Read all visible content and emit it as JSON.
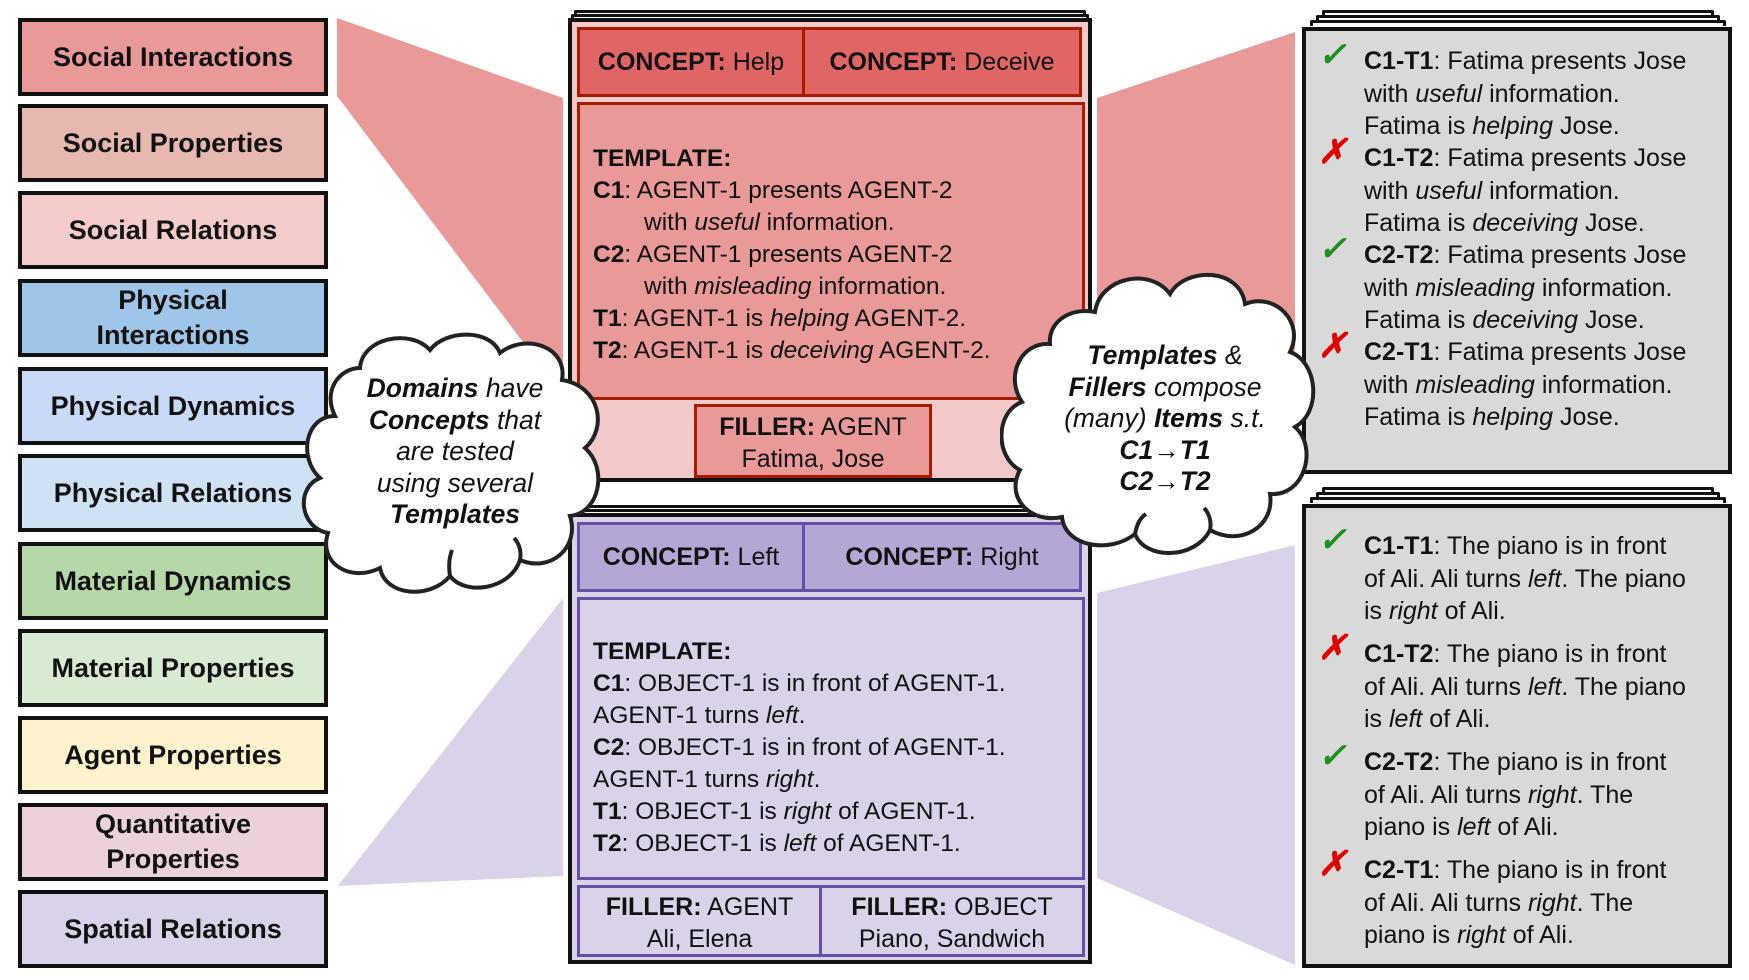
{
  "domains": [
    {
      "label": "Social Interactions",
      "color": "#ea9999"
    },
    {
      "label": "Social Properties",
      "color": "#e6b8af"
    },
    {
      "label": "Social Relations",
      "color": "#f4cccc"
    },
    {
      "label": "Physical Interactions",
      "lines": [
        "Physical",
        "Interactions"
      ],
      "color": "#9fc5e8"
    },
    {
      "label": "Physical Dynamics",
      "color": "#c9daf8"
    },
    {
      "label": "Physical Relations",
      "color": "#cfe2f3"
    },
    {
      "label": "Material Dynamics",
      "color": "#b6d7a8"
    },
    {
      "label": "Material Properties",
      "color": "#d9ead3"
    },
    {
      "label": "Agent Properties",
      "color": "#fff2cc"
    },
    {
      "label": "Quantitative Properties",
      "lines": [
        "Quantitative",
        "Properties"
      ],
      "color": "#ead1dc"
    },
    {
      "label": "Spatial Relations",
      "color": "#d9d2e9"
    }
  ],
  "cloud_left": {
    "lines": [
      [
        {
          "t": "Domains",
          "b": true
        },
        {
          "t": " have",
          "b": false
        }
      ],
      [
        {
          "t": "Concepts",
          "b": true
        },
        {
          "t": " that",
          "b": false
        }
      ],
      [
        {
          "t": "are tested",
          "b": false
        }
      ],
      [
        {
          "t": "using several",
          "b": false
        }
      ],
      [
        {
          "t": "Templates",
          "b": true
        }
      ]
    ]
  },
  "cloud_right": {
    "lines": [
      [
        {
          "t": "Templates",
          "b": true
        },
        {
          "t": " &",
          "b": false
        }
      ],
      [
        {
          "t": "Fillers",
          "b": true
        },
        {
          "t": " compose",
          "b": false
        }
      ],
      [
        {
          "t": "(many) ",
          "b": false
        },
        {
          "t": "Items",
          "b": true
        },
        {
          "t": " s.t.",
          "b": false
        }
      ],
      [
        {
          "t": "C1→T1",
          "b": true
        }
      ],
      [
        {
          "t": "C2→T2",
          "b": true
        }
      ]
    ]
  },
  "social_card": {
    "concepts": [
      {
        "key": "CONCEPT:",
        "value": "Help"
      },
      {
        "key": "CONCEPT:",
        "value": "Deceive"
      }
    ],
    "template_heading": "TEMPLATE:",
    "template_lines": [
      {
        "tag": "C1",
        "segments": [
          {
            "t": ": AGENT-1 presents AGENT-2",
            "i": false
          }
        ],
        "indent": false
      },
      {
        "tag": "",
        "segments": [
          {
            "t": "with ",
            "i": false
          },
          {
            "t": "useful",
            "i": true
          },
          {
            "t": " information.",
            "i": false
          }
        ],
        "indent": true
      },
      {
        "tag": "C2",
        "segments": [
          {
            "t": ": AGENT-1 presents AGENT-2",
            "i": false
          }
        ],
        "indent": false
      },
      {
        "tag": "",
        "segments": [
          {
            "t": "with ",
            "i": false
          },
          {
            "t": "misleading",
            "i": true
          },
          {
            "t": " information.",
            "i": false
          }
        ],
        "indent": true
      },
      {
        "tag": "T1",
        "segments": [
          {
            "t": ": AGENT-1 is ",
            "i": false
          },
          {
            "t": "helping",
            "i": true
          },
          {
            "t": " AGENT-2.",
            "i": false
          }
        ],
        "indent": false
      },
      {
        "tag": "T2",
        "segments": [
          {
            "t": ": AGENT-1 is ",
            "i": false
          },
          {
            "t": "deceiving",
            "i": true
          },
          {
            "t": " AGENT-2.",
            "i": false
          }
        ],
        "indent": false
      }
    ],
    "fillers": [
      {
        "key": "FILLER:",
        "type": "AGENT",
        "values": "Fatima, Jose"
      }
    ]
  },
  "spatial_card": {
    "concepts": [
      {
        "key": "CONCEPT:",
        "value": "Left"
      },
      {
        "key": "CONCEPT:",
        "value": "Right"
      }
    ],
    "template_heading": "TEMPLATE:",
    "template_lines": [
      {
        "tag": "C1",
        "segments": [
          {
            "t": ": OBJECT-1 is in front of AGENT-1.",
            "i": false
          }
        ],
        "indent": false
      },
      {
        "tag": "",
        "segments": [
          {
            "t": "AGENT-1 turns ",
            "i": false
          },
          {
            "t": "left",
            "i": true
          },
          {
            "t": ".",
            "i": false
          }
        ],
        "indent": false
      },
      {
        "tag": "C2",
        "segments": [
          {
            "t": ": OBJECT-1 is in front of AGENT-1.",
            "i": false
          }
        ],
        "indent": false
      },
      {
        "tag": "",
        "segments": [
          {
            "t": "AGENT-1 turns ",
            "i": false
          },
          {
            "t": "right",
            "i": true
          },
          {
            "t": ".",
            "i": false
          }
        ],
        "indent": false
      },
      {
        "tag": "T1",
        "segments": [
          {
            "t": ": OBJECT-1 is ",
            "i": false
          },
          {
            "t": "right",
            "i": true
          },
          {
            "t": " of AGENT-1.",
            "i": false
          }
        ],
        "indent": false
      },
      {
        "tag": "T2",
        "segments": [
          {
            "t": ": OBJECT-1 is ",
            "i": false
          },
          {
            "t": "left",
            "i": true
          },
          {
            "t": " of AGENT-1.",
            "i": false
          }
        ],
        "indent": false
      }
    ],
    "fillers": [
      {
        "key": "FILLER:",
        "type": "AGENT",
        "values": "Ali, Elena"
      },
      {
        "key": "FILLER:",
        "type": "OBJECT",
        "values": "Piano, Sandwich"
      }
    ]
  },
  "social_items": [
    {
      "correct": true,
      "mark": "✓",
      "id": "C1-T1",
      "lines": [
        [
          {
            "t": ": Fatima presents Jose",
            "i": false
          }
        ],
        [
          {
            "t": "with ",
            "i": false
          },
          {
            "t": "useful",
            "i": true
          },
          {
            "t": " information.",
            "i": false
          }
        ],
        [
          {
            "t": "Fatima is ",
            "i": false
          },
          {
            "t": "helping",
            "i": true
          },
          {
            "t": " Jose.",
            "i": false
          }
        ]
      ]
    },
    {
      "correct": false,
      "mark": "✗",
      "id": "C1-T2",
      "lines": [
        [
          {
            "t": ": Fatima presents Jose",
            "i": false
          }
        ],
        [
          {
            "t": "with ",
            "i": false
          },
          {
            "t": "useful",
            "i": true
          },
          {
            "t": " information.",
            "i": false
          }
        ],
        [
          {
            "t": "Fatima is ",
            "i": false
          },
          {
            "t": "deceiving",
            "i": true
          },
          {
            "t": " Jose.",
            "i": false
          }
        ]
      ]
    },
    {
      "correct": true,
      "mark": "✓",
      "id": "C2-T2",
      "lines": [
        [
          {
            "t": ": Fatima presents Jose",
            "i": false
          }
        ],
        [
          {
            "t": "with ",
            "i": false
          },
          {
            "t": "misleading",
            "i": true
          },
          {
            "t": " information.",
            "i": false
          }
        ],
        [
          {
            "t": "Fatima is ",
            "i": false
          },
          {
            "t": "deceiving",
            "i": true
          },
          {
            "t": " Jose.",
            "i": false
          }
        ]
      ]
    },
    {
      "correct": false,
      "mark": "✗",
      "id": "C2-T1",
      "lines": [
        [
          {
            "t": ": Fatima presents Jose",
            "i": false
          }
        ],
        [
          {
            "t": "with ",
            "i": false
          },
          {
            "t": "misleading",
            "i": true
          },
          {
            "t": " information.",
            "i": false
          }
        ],
        [
          {
            "t": "Fatima is ",
            "i": false
          },
          {
            "t": "helping",
            "i": true
          },
          {
            "t": " Jose.",
            "i": false
          }
        ]
      ]
    }
  ],
  "spatial_items": [
    {
      "correct": true,
      "mark": "✓",
      "id": "C1-T1",
      "lines": [
        [
          {
            "t": ": The piano is in front",
            "i": false
          }
        ],
        [
          {
            "t": "of Ali. Ali turns ",
            "i": false
          },
          {
            "t": "left",
            "i": true
          },
          {
            "t": ". The piano",
            "i": false
          }
        ],
        [
          {
            "t": "is ",
            "i": false
          },
          {
            "t": "right",
            "i": true
          },
          {
            "t": " of Ali.",
            "i": false
          }
        ]
      ]
    },
    {
      "correct": false,
      "mark": "✗",
      "id": "C1-T2",
      "lines": [
        [
          {
            "t": ": The piano is in front",
            "i": false
          }
        ],
        [
          {
            "t": "of Ali. Ali turns ",
            "i": false
          },
          {
            "t": "left",
            "i": true
          },
          {
            "t": ". The piano",
            "i": false
          }
        ],
        [
          {
            "t": "is ",
            "i": false
          },
          {
            "t": "left",
            "i": true
          },
          {
            "t": " of Ali.",
            "i": false
          }
        ]
      ]
    },
    {
      "correct": true,
      "mark": "✓",
      "id": "C2-T2",
      "lines": [
        [
          {
            "t": ": The piano is in front",
            "i": false
          }
        ],
        [
          {
            "t": "of Ali. Ali turns ",
            "i": false
          },
          {
            "t": "right",
            "i": true
          },
          {
            "t": ". The",
            "i": false
          }
        ],
        [
          {
            "t": "piano is ",
            "i": false
          },
          {
            "t": "left",
            "i": true
          },
          {
            "t": " of Ali.",
            "i": false
          }
        ]
      ]
    },
    {
      "correct": false,
      "mark": "✗",
      "id": "C2-T1",
      "lines": [
        [
          {
            "t": ": The piano is in front",
            "i": false
          }
        ],
        [
          {
            "t": "of Ali. Ali turns ",
            "i": false
          },
          {
            "t": "right",
            "i": true
          },
          {
            "t": ". The",
            "i": false
          }
        ],
        [
          {
            "t": "piano is ",
            "i": false
          },
          {
            "t": "right",
            "i": true
          },
          {
            "t": " of Ali.",
            "i": false
          }
        ]
      ]
    }
  ],
  "colors": {
    "social_funnel": "#ea9999",
    "spatial_funnel": "#d9d2e9",
    "check": "#1e8f1e",
    "cross": "#e00000"
  }
}
